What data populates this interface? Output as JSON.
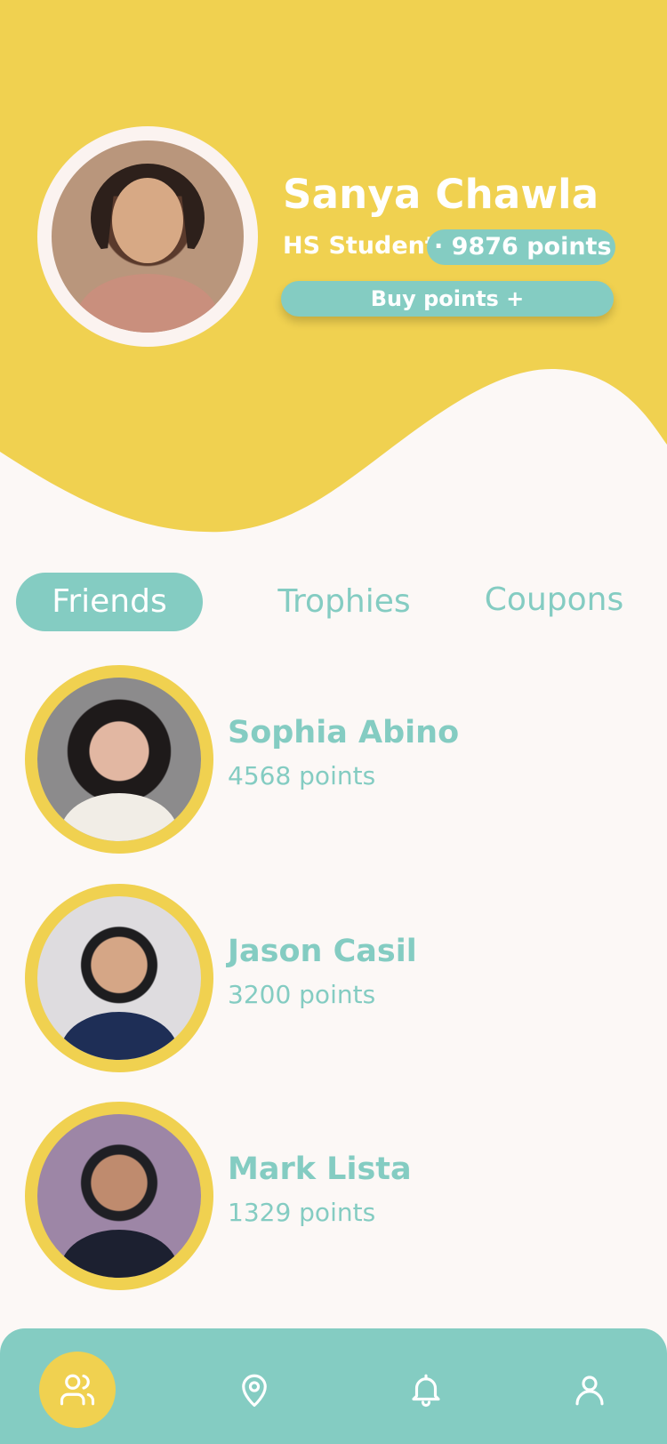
{
  "profile": {
    "name": "Sanya Chawla",
    "role": "HS Student",
    "points": "· 9876 points",
    "buy_label": "Buy points +"
  },
  "tabs": [
    {
      "label": "Friends",
      "active": true
    },
    {
      "label": "Trophies",
      "active": false
    },
    {
      "label": "Coupons",
      "active": false
    }
  ],
  "friends": [
    {
      "name": "Sophia Abino",
      "points": "4568 points"
    },
    {
      "name": "Jason Casil",
      "points": "3200 points"
    },
    {
      "name": "Mark Lista",
      "points": "1329 points"
    }
  ],
  "nav": [
    {
      "icon": "friends-icon",
      "active": true
    },
    {
      "icon": "location-pin-icon",
      "active": false
    },
    {
      "icon": "bell-icon",
      "active": false
    },
    {
      "icon": "user-icon",
      "active": false
    }
  ],
  "colors": {
    "yellow": "#F0D150",
    "teal": "#84CCC2",
    "background": "#FCF8F6",
    "white": "#FFFFFF"
  }
}
